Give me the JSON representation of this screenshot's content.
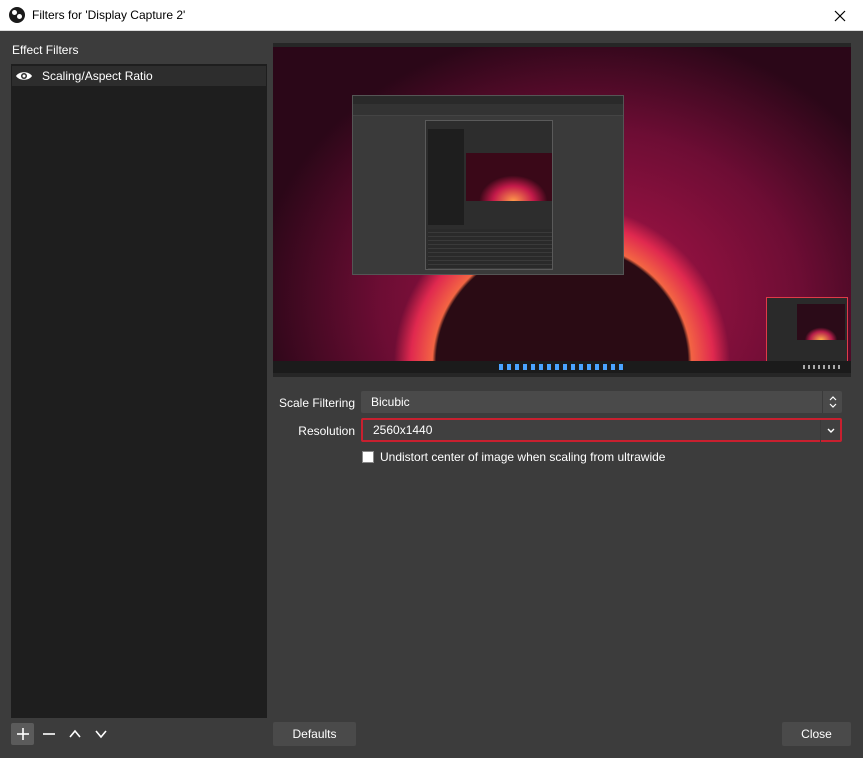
{
  "window": {
    "title": "Filters for 'Display Capture 2'"
  },
  "left": {
    "section_label": "Effect Filters",
    "filters": [
      {
        "label": "Scaling/Aspect Ratio",
        "icon": "eye-icon",
        "visible": true
      }
    ],
    "tools": [
      "plus-icon",
      "minus-icon",
      "chevron-up-icon",
      "chevron-down-icon"
    ]
  },
  "form": {
    "scale_filtering_label": "Scale Filtering",
    "scale_filtering_value": "Bicubic",
    "resolution_label": "Resolution",
    "resolution_value": "2560x1440",
    "undistort_label": "Undistort center of image when scaling from ultrawide",
    "undistort_checked": false
  },
  "buttons": {
    "defaults": "Defaults",
    "close": "Close"
  },
  "colors": {
    "accent_focus": "#c8202f",
    "panel_bg": "#3c3c3c",
    "list_bg": "#1e1e1e"
  }
}
